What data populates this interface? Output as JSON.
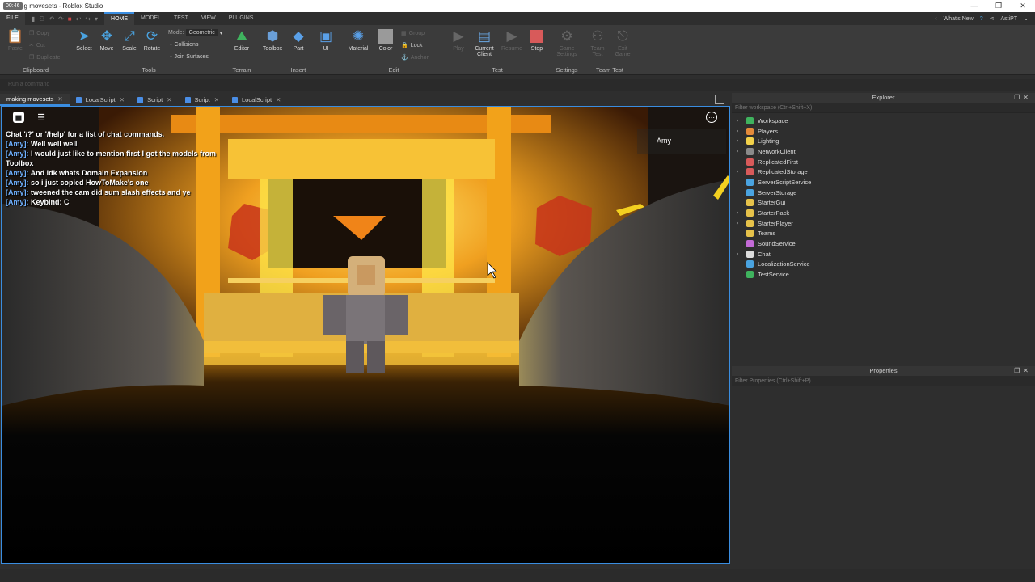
{
  "window": {
    "timer": "00:46",
    "title": "g movesets - Roblox Studio",
    "controls": [
      "—",
      "❐",
      "✕"
    ]
  },
  "menubar": {
    "file": "FILE",
    "tabs": [
      "HOME",
      "MODEL",
      "TEST",
      "VIEW",
      "PLUGINS"
    ],
    "whats_new": "What's New",
    "user": "AstiPT"
  },
  "ribbon": {
    "clipboard": {
      "label": "Clipboard",
      "paste": "Paste",
      "copy": "Copy",
      "cut": "Cut",
      "duplicate": "Duplicate"
    },
    "tools": {
      "label": "Tools",
      "select": "Select",
      "move": "Move",
      "scale": "Scale",
      "rotate": "Rotate",
      "mode_label": "Mode:",
      "mode_value": "Geometric",
      "collisions": "Collisions",
      "join_surfaces": "Join Surfaces"
    },
    "terrain": {
      "label": "Terrain",
      "editor": "Editor"
    },
    "insert": {
      "label": "Insert",
      "toolbox": "Toolbox",
      "part": "Part",
      "ui": "UI"
    },
    "edit": {
      "label": "Edit",
      "material": "Material",
      "color": "Color",
      "group": "Group",
      "lock": "Lock",
      "anchor": "Anchor"
    },
    "test": {
      "label": "Test",
      "play": "Play",
      "current_client_1": "Current",
      "current_client_2": "Client",
      "resume": "Resume",
      "stop": "Stop"
    },
    "settings": {
      "label": "Settings",
      "game_settings_1": "Game",
      "game_settings_2": "Settings"
    },
    "team_test": {
      "label": "Team Test",
      "team_test_1": "Team",
      "team_test_2": "Test",
      "exit_game_1": "Exit",
      "exit_game_2": "Game"
    }
  },
  "command_bar": {
    "placeholder": "Run a command"
  },
  "doc_tabs": [
    {
      "label": "making movesets",
      "active": true
    },
    {
      "label": "LocalScript"
    },
    {
      "label": "Script"
    },
    {
      "label": "Script"
    },
    {
      "label": "LocalScript"
    }
  ],
  "chat": {
    "lines": [
      {
        "name": "",
        "text": "Chat '/?' or '/help' for a list of chat commands."
      },
      {
        "name": "[Amy]:",
        "text": " Well well well"
      },
      {
        "name": "[Amy]:",
        "text": " I would just like to mention first I got the models from Toolbox"
      },
      {
        "name": "[Amy]:",
        "text": " And idk whats Domain Expansion"
      },
      {
        "name": "[Amy]:",
        "text": " so i just copied HowToMake's one"
      },
      {
        "name": "[Amy]:",
        "text": " tweened the cam did sum slash effects and ye"
      },
      {
        "name": "[Amy]:",
        "text": " Keybind: C"
      }
    ]
  },
  "player_list": {
    "player": "Amy"
  },
  "explorer": {
    "title": "Explorer",
    "filter_placeholder": "Filter workspace (Ctrl+Shift+X)",
    "items": [
      {
        "label": "Workspace",
        "arrow": "›",
        "color": "#3fb35e"
      },
      {
        "label": "Players",
        "arrow": "›",
        "color": "#e48a3a"
      },
      {
        "label": "Lighting",
        "arrow": "›",
        "color": "#f2d14a"
      },
      {
        "label": "NetworkClient",
        "arrow": "›",
        "color": "#8a8a8a"
      },
      {
        "label": "ReplicatedFirst",
        "arrow": "",
        "color": "#d85a5a"
      },
      {
        "label": "ReplicatedStorage",
        "arrow": "›",
        "color": "#d85a5a"
      },
      {
        "label": "ServerScriptService",
        "arrow": "",
        "color": "#4aa3e0"
      },
      {
        "label": "ServerStorage",
        "arrow": "",
        "color": "#4aa3e0"
      },
      {
        "label": "StarterGui",
        "arrow": "",
        "color": "#e6c24a"
      },
      {
        "label": "StarterPack",
        "arrow": "›",
        "color": "#e6c24a"
      },
      {
        "label": "StarterPlayer",
        "arrow": "›",
        "color": "#e6c24a"
      },
      {
        "label": "Teams",
        "arrow": "",
        "color": "#e6c24a"
      },
      {
        "label": "SoundService",
        "arrow": "",
        "color": "#c36ad6"
      },
      {
        "label": "Chat",
        "arrow": "›",
        "color": "#dddddd"
      },
      {
        "label": "LocalizationService",
        "arrow": "",
        "color": "#4aa3e0"
      },
      {
        "label": "TestService",
        "arrow": "",
        "color": "#3fb35e"
      }
    ]
  },
  "properties": {
    "title": "Properties",
    "filter_placeholder": "Filter Properties (Ctrl+Shift+P)"
  },
  "colors": {
    "accent": "#3a8de0",
    "panel_bg": "#2e2e2e",
    "ribbon_bg": "#3b3b3b"
  }
}
